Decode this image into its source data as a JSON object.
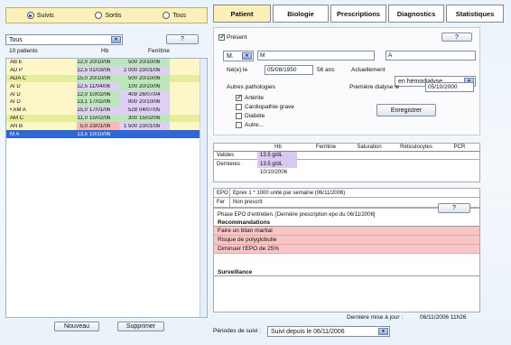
{
  "filter_radio": [
    {
      "label": "Suivis",
      "selected": true
    },
    {
      "label": "Sortis",
      "selected": false
    },
    {
      "label": "Tous",
      "selected": false
    }
  ],
  "patient_filter_select": "Tous",
  "help_button": "?",
  "patient_list": {
    "count_label": "10 patients",
    "headers": {
      "hb": "Hb",
      "ferritine": "Ferritine"
    },
    "rows": [
      {
        "name": "AB E",
        "hb": "12,0",
        "hb_date": "20/10/06",
        "ferritine": "500",
        "ferr_date": "20/10/06",
        "bg": "#fdf7c8",
        "hbcolor": "#bde6bd",
        "ferrcolor": "#bde6bd"
      },
      {
        "name": "AD P",
        "hb": "12,5",
        "hb_date": "01/03/06",
        "ferritine": "2 000",
        "ferr_date": "23/01/06",
        "bg": "#fdf7c8",
        "hbcolor": "#ded0f2",
        "ferrcolor": "#ded0f2"
      },
      {
        "name": "ADA C",
        "hb": "15,0",
        "hb_date": "20/10/06",
        "ferritine": "500",
        "ferr_date": "20/10/06",
        "bg": "#e6ed9c",
        "hbcolor": "#bde6bd",
        "ferrcolor": "#bde6bd"
      },
      {
        "name": "AI D",
        "hb": "12,5",
        "hb_date": "11/04/06",
        "ferritine": "100",
        "ferr_date": "20/10/06",
        "bg": "#fdf7c8",
        "hbcolor": "#ded0f2",
        "ferrcolor": "#bde6bd"
      },
      {
        "name": "AI D",
        "hb": "12,0",
        "hb_date": "10/02/06",
        "ferritine": "409",
        "ferr_date": "26/07/04",
        "bg": "#fdf7c8",
        "hbcolor": "#bde6bd",
        "ferrcolor": "#ded0f2"
      },
      {
        "name": "AI D",
        "hb": "13,1",
        "hb_date": "17/02/06",
        "ferritine": "800",
        "ferr_date": "20/10/06",
        "bg": "#fdf7c8",
        "hbcolor": "#bde6bd",
        "ferrcolor": "#ded0f2"
      },
      {
        "name": "• AM A",
        "hb": "15,0",
        "hb_date": "17/01/06",
        "ferritine": "528",
        "ferr_date": "04/07/05",
        "bg": "#fdf7c8",
        "hbcolor": "#ded0f2",
        "ferrcolor": "#ded0f2"
      },
      {
        "name": "AM C",
        "hb": "11,0",
        "hb_date": "15/02/06",
        "ferritine": "300",
        "ferr_date": "15/02/06",
        "bg": "#e6ed9c",
        "hbcolor": "#bde6bd",
        "ferrcolor": "#bde6bd"
      },
      {
        "name": "AN B",
        "hb": "5,0",
        "hb_date": "23/01/06",
        "ferritine": "1 500",
        "ferr_date": "23/01/06",
        "bg": "#fdf7c8",
        "hbcolor": "#f6b9b9",
        "ferrcolor": "#ded0f2"
      },
      {
        "name": "M A",
        "hb": "13,5",
        "hb_date": "10/10/06",
        "ferritine": "",
        "ferr_date": "",
        "bg": "#2f67d3",
        "hbcolor": "#2f67d3",
        "ferrcolor": "#2f67d3",
        "selected": true
      }
    ]
  },
  "bottom_buttons": {
    "new": "Nouveau",
    "delete": "Supprimer"
  },
  "tabs": [
    {
      "label": "Patient",
      "active": true
    },
    {
      "label": "Biologie",
      "active": false
    },
    {
      "label": "Prescriptions",
      "active": false
    },
    {
      "label": "Diagnostics",
      "active": false
    },
    {
      "label": "Statistiques",
      "active": false
    }
  ],
  "patient_form": {
    "present_label": "Présent",
    "present_checked": true,
    "civility": "M.",
    "last_name": "M",
    "first_name": "A",
    "birth_label": "Né(e) le",
    "birth_date": "05/08/1950",
    "age": "56 ans",
    "current_label": "Actuellement",
    "current_status": "en hémodialyse",
    "other_pathologies_label": "Autres pathologies",
    "first_dialysis_label": "Première dialyse le",
    "first_dialysis": "05/10/2000",
    "pathologies": [
      {
        "label": "Artérite",
        "checked": true
      },
      {
        "label": "Cardiopathie grave",
        "checked": false
      },
      {
        "label": "Diabète",
        "checked": false
      },
      {
        "label": "Autre...",
        "checked": false
      }
    ],
    "save_button": "Enregistrer"
  },
  "bio_table": {
    "headers": [
      "Hb",
      "Ferritine",
      "Saturation",
      "Réticulocytes",
      "PCR"
    ],
    "rows": [
      {
        "label": "Valides",
        "hb": "13.5 g/dL"
      },
      {
        "label": "Dernieres",
        "hb": "13.5 g/dL",
        "date": "10/10/2006"
      }
    ]
  },
  "epo_fer": [
    {
      "label": "EPO",
      "value": "Eprex 1 * 1000 unité par semaine (06/11/2006)"
    },
    {
      "label": "Fer",
      "value": "Non prescrit"
    }
  ],
  "phase_text": "Phase EPO d'entretien. [Dernière prescription epo du 06/11/2006]",
  "recommandations_title": "Recommandations",
  "recommandations": [
    "Faire un bilan martial",
    "Risque de polyglobulie",
    "Diminuer l'EPO de 25%"
  ],
  "surveillance_title": "Surveillance",
  "last_update_label": "Dernière mise à jour :",
  "last_update_value": "06/11/2006  11h26",
  "periods_label": "Périodes de suivi :",
  "periods_value": "Suivi depuis le 06/11/2006",
  "colors": {
    "selection": "#2f67d3",
    "tab_active": "#fbf0b9",
    "reco_bg": "#f8c6c6"
  }
}
